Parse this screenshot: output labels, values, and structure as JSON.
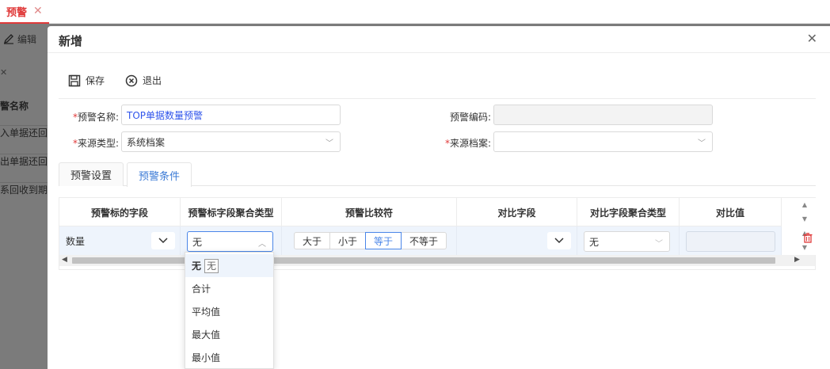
{
  "tabstrip": {
    "tab_label": "预警"
  },
  "background": {
    "toolbar_edit": "编辑",
    "column_header": "警名称",
    "rows": [
      "入单据还回预",
      "出单据还回预",
      "系回收到期预"
    ]
  },
  "modal": {
    "title": "新增",
    "toolbar": {
      "save": "保存",
      "exit": "退出"
    },
    "form": {
      "name_label": "预警名称:",
      "name_value": "TOP单据数量预警",
      "code_label": "预警编码:",
      "code_value": "",
      "source_type_label": "来源类型:",
      "source_type_value": "系统档案",
      "source_archive_label": "来源档案:",
      "source_archive_value": ""
    },
    "tabs": [
      {
        "label": "预警设置",
        "active": false
      },
      {
        "label": "预警条件",
        "active": true
      }
    ],
    "grid": {
      "columns": [
        "预警标的字段",
        "预警标字段聚合类型",
        "预警比较符",
        "对比字段",
        "对比字段聚合类型",
        "对比值"
      ],
      "row": {
        "field": "数量",
        "agg_type": "无",
        "comparators": [
          "大于",
          "小于",
          "等于",
          "不等于"
        ],
        "active_comparator": "等于",
        "compare_field": "",
        "compare_agg_type": "无",
        "compare_value": ""
      }
    },
    "dropdown": {
      "options": [
        "无",
        "合计",
        "平均值",
        "最大值",
        "最小值"
      ],
      "selected": "无",
      "tooltip": "无"
    }
  },
  "colors": {
    "accent": "#4a86e8",
    "danger": "#e03a3a",
    "tab_active": "#3c7bd6"
  }
}
